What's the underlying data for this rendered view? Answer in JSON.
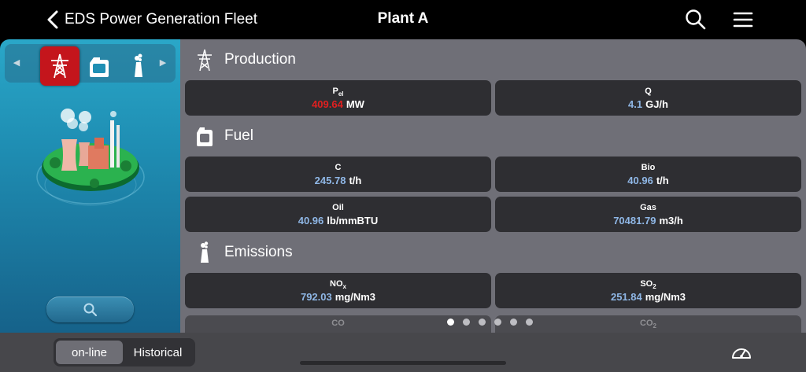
{
  "navbar": {
    "back_label": "EDS Power Generation Fleet",
    "title": "Plant A",
    "icons": [
      "chevron-left-icon",
      "search-icon",
      "menu-icon"
    ]
  },
  "sidebar": {
    "categories": [
      {
        "name": "production",
        "icon": "power-tower-icon",
        "active": true
      },
      {
        "name": "fuel",
        "icon": "fuel-can-icon",
        "active": false
      },
      {
        "name": "emissions",
        "icon": "chimney-icon",
        "active": false
      }
    ],
    "search_icon": "search-icon"
  },
  "sections": {
    "production": {
      "title": "Production",
      "cards": [
        {
          "label": "P",
          "label_sub": "el",
          "value": "409.64",
          "unit": "MW",
          "alarm": true
        },
        {
          "label": "Q",
          "label_sub": "",
          "value": "4.1",
          "unit": "GJ/h",
          "alarm": false
        }
      ]
    },
    "fuel": {
      "title": "Fuel",
      "cards": [
        {
          "label": "C",
          "label_sub": "",
          "value": "245.78",
          "unit": "t/h"
        },
        {
          "label": "Bio",
          "label_sub": "",
          "value": "40.96",
          "unit": "t/h"
        },
        {
          "label": "Oil",
          "label_sub": "",
          "value": "40.96",
          "unit": "lb/mmBTU"
        },
        {
          "label": "Gas",
          "label_sub": "",
          "value": "70481.79",
          "unit": "m3/h"
        }
      ]
    },
    "emissions": {
      "title": "Emissions",
      "cards": [
        {
          "label": "NO",
          "label_sub": "x",
          "value": "792.03",
          "unit": "mg/Nm3"
        },
        {
          "label": "SO",
          "label_sub": "2",
          "value": "251.84",
          "unit": "mg/Nm3"
        },
        {
          "label": "CO",
          "label_sub": "",
          "value": "",
          "unit": ""
        },
        {
          "label": "CO",
          "label_sub": "2",
          "value": "",
          "unit": ""
        }
      ]
    }
  },
  "pager": {
    "count": 6,
    "active": 0
  },
  "bottombar": {
    "mode_online": "on-line",
    "mode_historical": "Historical",
    "selected": "on-line",
    "gauge_icon": "gauge-icon"
  },
  "colors": {
    "alarm": "#e02020",
    "value": "#8fb7e6",
    "active_category": "#c4151c",
    "content_bg": "#6f6f77",
    "card_bg": "#2e2e32"
  }
}
